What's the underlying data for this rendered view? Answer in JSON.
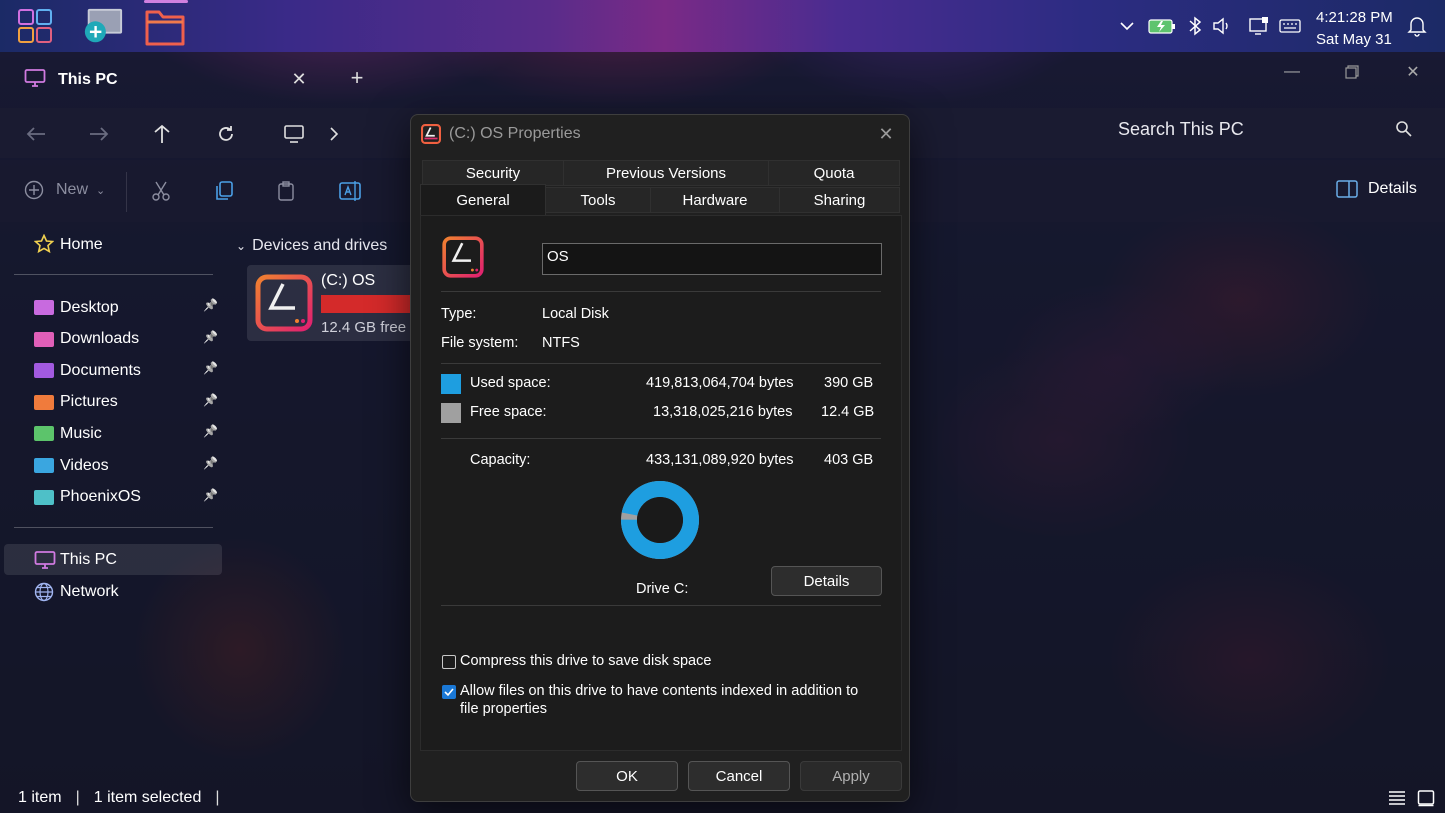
{
  "taskbar": {
    "clock_time": "4:21:28 PM",
    "clock_date": "Sat May 31",
    "icons": [
      "launcher-grid-icon",
      "magnifier-icon",
      "file-manager-icon",
      "chevron-down-icon",
      "battery-icon",
      "bluetooth-icon",
      "volume-icon",
      "screen-icon",
      "keyboard-icon",
      "bell-icon"
    ]
  },
  "explorer": {
    "tab_title": "This PC",
    "search_placeholder": "Search This PC",
    "toolbar": {
      "new_label": "New",
      "details_label": "Details"
    },
    "sidebar": {
      "home": "Home",
      "quick_access": [
        {
          "label": "Desktop",
          "color": "#c86adf"
        },
        {
          "label": "Downloads",
          "color": "#e05fb8"
        },
        {
          "label": "Documents",
          "color": "#a25ae0"
        },
        {
          "label": "Pictures",
          "color": "#f07b3c"
        },
        {
          "label": "Music",
          "color": "#5cc46b"
        },
        {
          "label": "Videos",
          "color": "#3aa6e0"
        },
        {
          "label": "PhoenixOS",
          "color": "#4ec0c8"
        }
      ],
      "this_pc": "This PC",
      "network": "Network"
    },
    "section_title": "Devices and drives",
    "drive": {
      "name": "(C:) OS",
      "free_text": "12.4 GB free",
      "used_fraction": 0.97,
      "bar_color": "#d42a2a"
    },
    "status": {
      "items": "1 item",
      "selected": "1 item selected"
    }
  },
  "dialog": {
    "title": "(C:) OS Properties",
    "tabs_row1": [
      "Security",
      "Previous Versions",
      "Quota"
    ],
    "tabs_row2": [
      "General",
      "Tools",
      "Hardware",
      "Sharing"
    ],
    "active_tab": "General",
    "name_value": "OS",
    "type_label": "Type:",
    "type_value": "Local Disk",
    "fs_label": "File system:",
    "fs_value": "NTFS",
    "used_label": "Used space:",
    "used_bytes": "419,813,064,704 bytes",
    "used_size": "390 GB",
    "used_color": "#1e9ee0",
    "free_label": "Free space:",
    "free_bytes": "13,318,025,216 bytes",
    "free_size": "12.4 GB",
    "free_color": "#a0a0a0",
    "capacity_label": "Capacity:",
    "capacity_bytes": "433,131,089,920 bytes",
    "capacity_size": "403 GB",
    "used_fraction": 0.969,
    "drive_label": "Drive C:",
    "details_button": "Details",
    "compress_label": "Compress this drive to save disk space",
    "compress_checked": false,
    "index_label": "Allow files on this drive to have contents indexed in addition to file properties",
    "index_checked": true,
    "ok": "OK",
    "cancel": "Cancel",
    "apply": "Apply"
  }
}
